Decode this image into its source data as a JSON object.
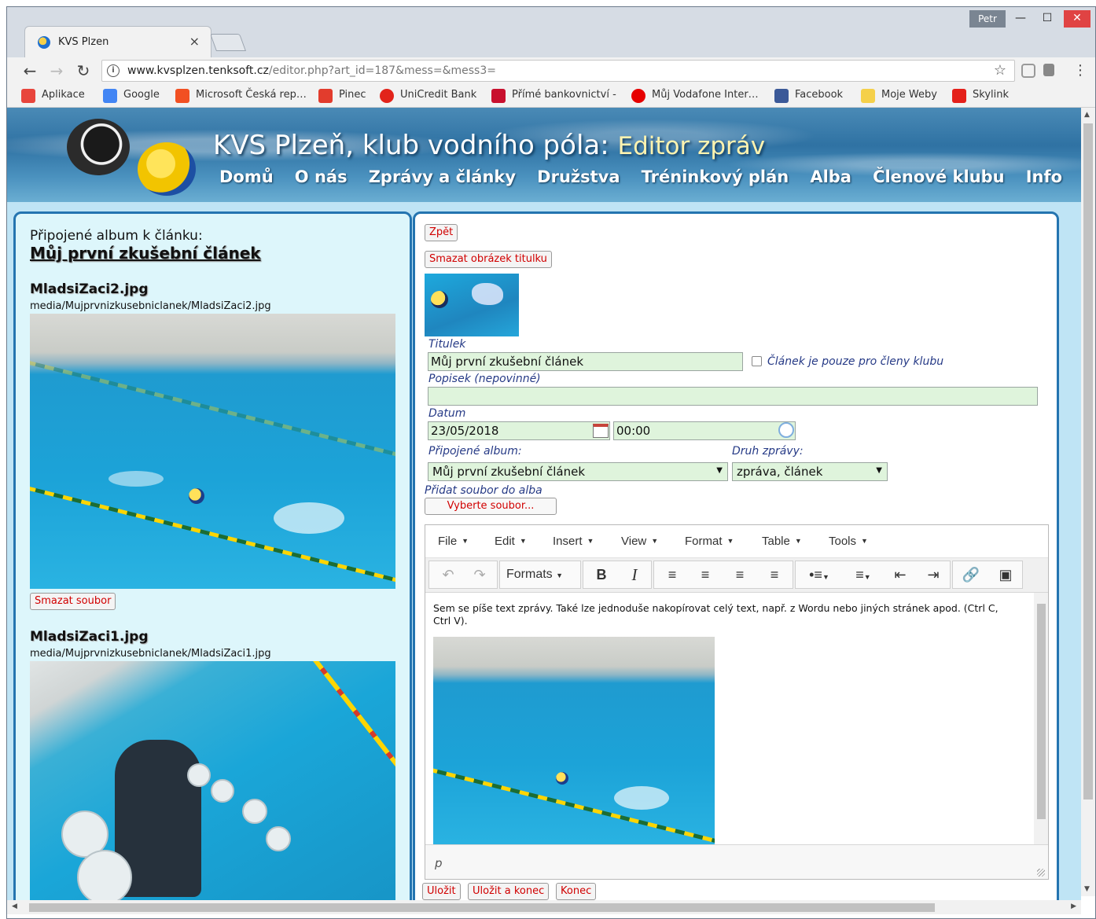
{
  "browser": {
    "tab_title": "KVS Plzen",
    "tab_close": "×",
    "user": "Petr",
    "url_host": "www.kvsplzen.tenksoft.cz",
    "url_path": "/editor.php?art_id=187&mess=&mess3=",
    "bookmarks": [
      {
        "label": "Aplikace",
        "icon": "apps-grid-icon",
        "color": "#e8453c"
      },
      {
        "label": "Google",
        "icon": "google-g-icon",
        "color": "#4285f4"
      },
      {
        "label": "Microsoft Česká rep…",
        "icon": "microsoft-icon",
        "color": "#f25022"
      },
      {
        "label": "Pinec",
        "icon": "pinec-icon",
        "color": "#e23c2d"
      },
      {
        "label": "UniCredit Bank",
        "icon": "unicredit-icon",
        "color": "#e2231a"
      },
      {
        "label": "Přímé bankovnictví -",
        "icon": "bank-icon",
        "color": "#c8102e"
      },
      {
        "label": "Můj Vodafone Inter…",
        "icon": "vodafone-icon",
        "color": "#e60000"
      },
      {
        "label": "Facebook",
        "icon": "facebook-icon",
        "color": "#3b5998"
      },
      {
        "label": "Moje Weby",
        "icon": "folder-icon",
        "color": "#f5d04a"
      },
      {
        "label": "Skylink",
        "icon": "skylink-icon",
        "color": "#e4201a"
      }
    ]
  },
  "site": {
    "title": "KVS Plzeň, klub vodního póla:",
    "subtitle": "Editor zpráv",
    "nav": [
      "Domů",
      "O nás",
      "Zprávy a články",
      "Družstva",
      "Tréninkový plán",
      "Alba",
      "Členové klubu",
      "Info"
    ]
  },
  "left": {
    "caption": "Připojené album k článku:",
    "album_title": "Můj první zkušební článek",
    "files": [
      {
        "name": "MladsiZaci2.jpg",
        "path": "media/Mujprvnizkusebniclanek/MladsiZaci2.jpg",
        "delete": "Smazat soubor"
      },
      {
        "name": "MladsiZaci1.jpg",
        "path": "media/Mujprvnizkusebniclanek/MladsiZaci1.jpg"
      }
    ]
  },
  "form": {
    "back": "Zpět",
    "delete_title_image": "Smazat obrázek titulku",
    "title_label": "Titulek",
    "title_value": "Můj první zkušební článek",
    "members_only_label": "Článek je pouze pro členy klubu",
    "members_only_checked": false,
    "caption_label": "Popisek (nepovinné)",
    "caption_value": "",
    "date_label": "Datum",
    "date_value": "23/05/2018",
    "time_value": "00:00",
    "album_label": "Připojené album:",
    "album_value": "Můj první zkušební článek",
    "type_label": "Druh zprávy:",
    "type_value": "zpráva, článek",
    "add_file_label": "Přidat soubor do alba",
    "choose_file": "Vyberte soubor..."
  },
  "editor": {
    "menu": [
      "File",
      "Edit",
      "Insert",
      "View",
      "Format",
      "Table",
      "Tools"
    ],
    "formats_label": "Formats",
    "content_text": "Sem se píše text zprávy. Také lze jednoduše nakopírovat celý text, např. z Wordu nebo jiných stránek apod. (Ctrl C, Ctrl V).",
    "status_path": "p"
  },
  "actions": {
    "save": "Uložit",
    "save_close": "Uložit a konec",
    "close": "Konec"
  }
}
